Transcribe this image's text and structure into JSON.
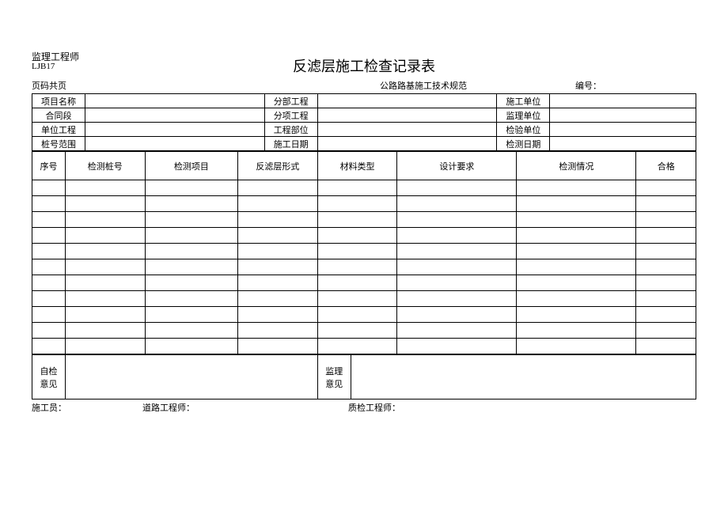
{
  "header": {
    "supervisor_label": "监理工程师",
    "form_code": "LJB17",
    "title": "反滤层施工检查记录表",
    "page_info": "页码共页",
    "standard": "公路路基施工技术规范",
    "serial_label": "编号：",
    "serial_value": ""
  },
  "info": {
    "labels": {
      "project_name": "项目名称",
      "subsection": "分部工程",
      "construction_unit": "施工单位",
      "contract": "合同段",
      "subitem": "分项工程",
      "supervision_unit": "监理单位",
      "unit_project": "单位工程",
      "project_part": "工程部位",
      "inspection_unit": "检验单位",
      "stake_range": "桩号范围",
      "construction_date": "施工日期",
      "test_date": "检测日期"
    },
    "values": {
      "project_name": "",
      "subsection": "",
      "construction_unit": "",
      "contract": "",
      "subitem": "",
      "supervision_unit": "",
      "unit_project": "",
      "project_part": "",
      "inspection_unit": "",
      "stake_range": "",
      "construction_date": "",
      "test_date": ""
    }
  },
  "columns": {
    "seq": "序号",
    "stake": "检测桩号",
    "item": "检测项目",
    "filter_form": "反滤层形式",
    "material_type": "材料类型",
    "design_req": "设计要求",
    "inspection": "检测情况",
    "qualified": "合格"
  },
  "data_rows": [
    {
      "seq": "",
      "stake": "",
      "item": "",
      "filter_form": "",
      "material_type": "",
      "design_req": "",
      "inspection": "",
      "qualified": ""
    },
    {
      "seq": "",
      "stake": "",
      "item": "",
      "filter_form": "",
      "material_type": "",
      "design_req": "",
      "inspection": "",
      "qualified": ""
    },
    {
      "seq": "",
      "stake": "",
      "item": "",
      "filter_form": "",
      "material_type": "",
      "design_req": "",
      "inspection": "",
      "qualified": ""
    },
    {
      "seq": "",
      "stake": "",
      "item": "",
      "filter_form": "",
      "material_type": "",
      "design_req": "",
      "inspection": "",
      "qualified": ""
    },
    {
      "seq": "",
      "stake": "",
      "item": "",
      "filter_form": "",
      "material_type": "",
      "design_req": "",
      "inspection": "",
      "qualified": ""
    },
    {
      "seq": "",
      "stake": "",
      "item": "",
      "filter_form": "",
      "material_type": "",
      "design_req": "",
      "inspection": "",
      "qualified": ""
    },
    {
      "seq": "",
      "stake": "",
      "item": "",
      "filter_form": "",
      "material_type": "",
      "design_req": "",
      "inspection": "",
      "qualified": ""
    },
    {
      "seq": "",
      "stake": "",
      "item": "",
      "filter_form": "",
      "material_type": "",
      "design_req": "",
      "inspection": "",
      "qualified": ""
    },
    {
      "seq": "",
      "stake": "",
      "item": "",
      "filter_form": "",
      "material_type": "",
      "design_req": "",
      "inspection": "",
      "qualified": ""
    },
    {
      "seq": "",
      "stake": "",
      "item": "",
      "filter_form": "",
      "material_type": "",
      "design_req": "",
      "inspection": "",
      "qualified": ""
    },
    {
      "seq": "",
      "stake": "",
      "item": "",
      "filter_form": "",
      "material_type": "",
      "design_req": "",
      "inspection": "",
      "qualified": ""
    }
  ],
  "opinion": {
    "self_label": "自检意见",
    "self_value": "",
    "supervision_label": "监理意见",
    "supervision_value": ""
  },
  "footer": {
    "constructor": "施工员：",
    "road_engineer": "道路工程师：",
    "quality_engineer": "质检工程师："
  }
}
